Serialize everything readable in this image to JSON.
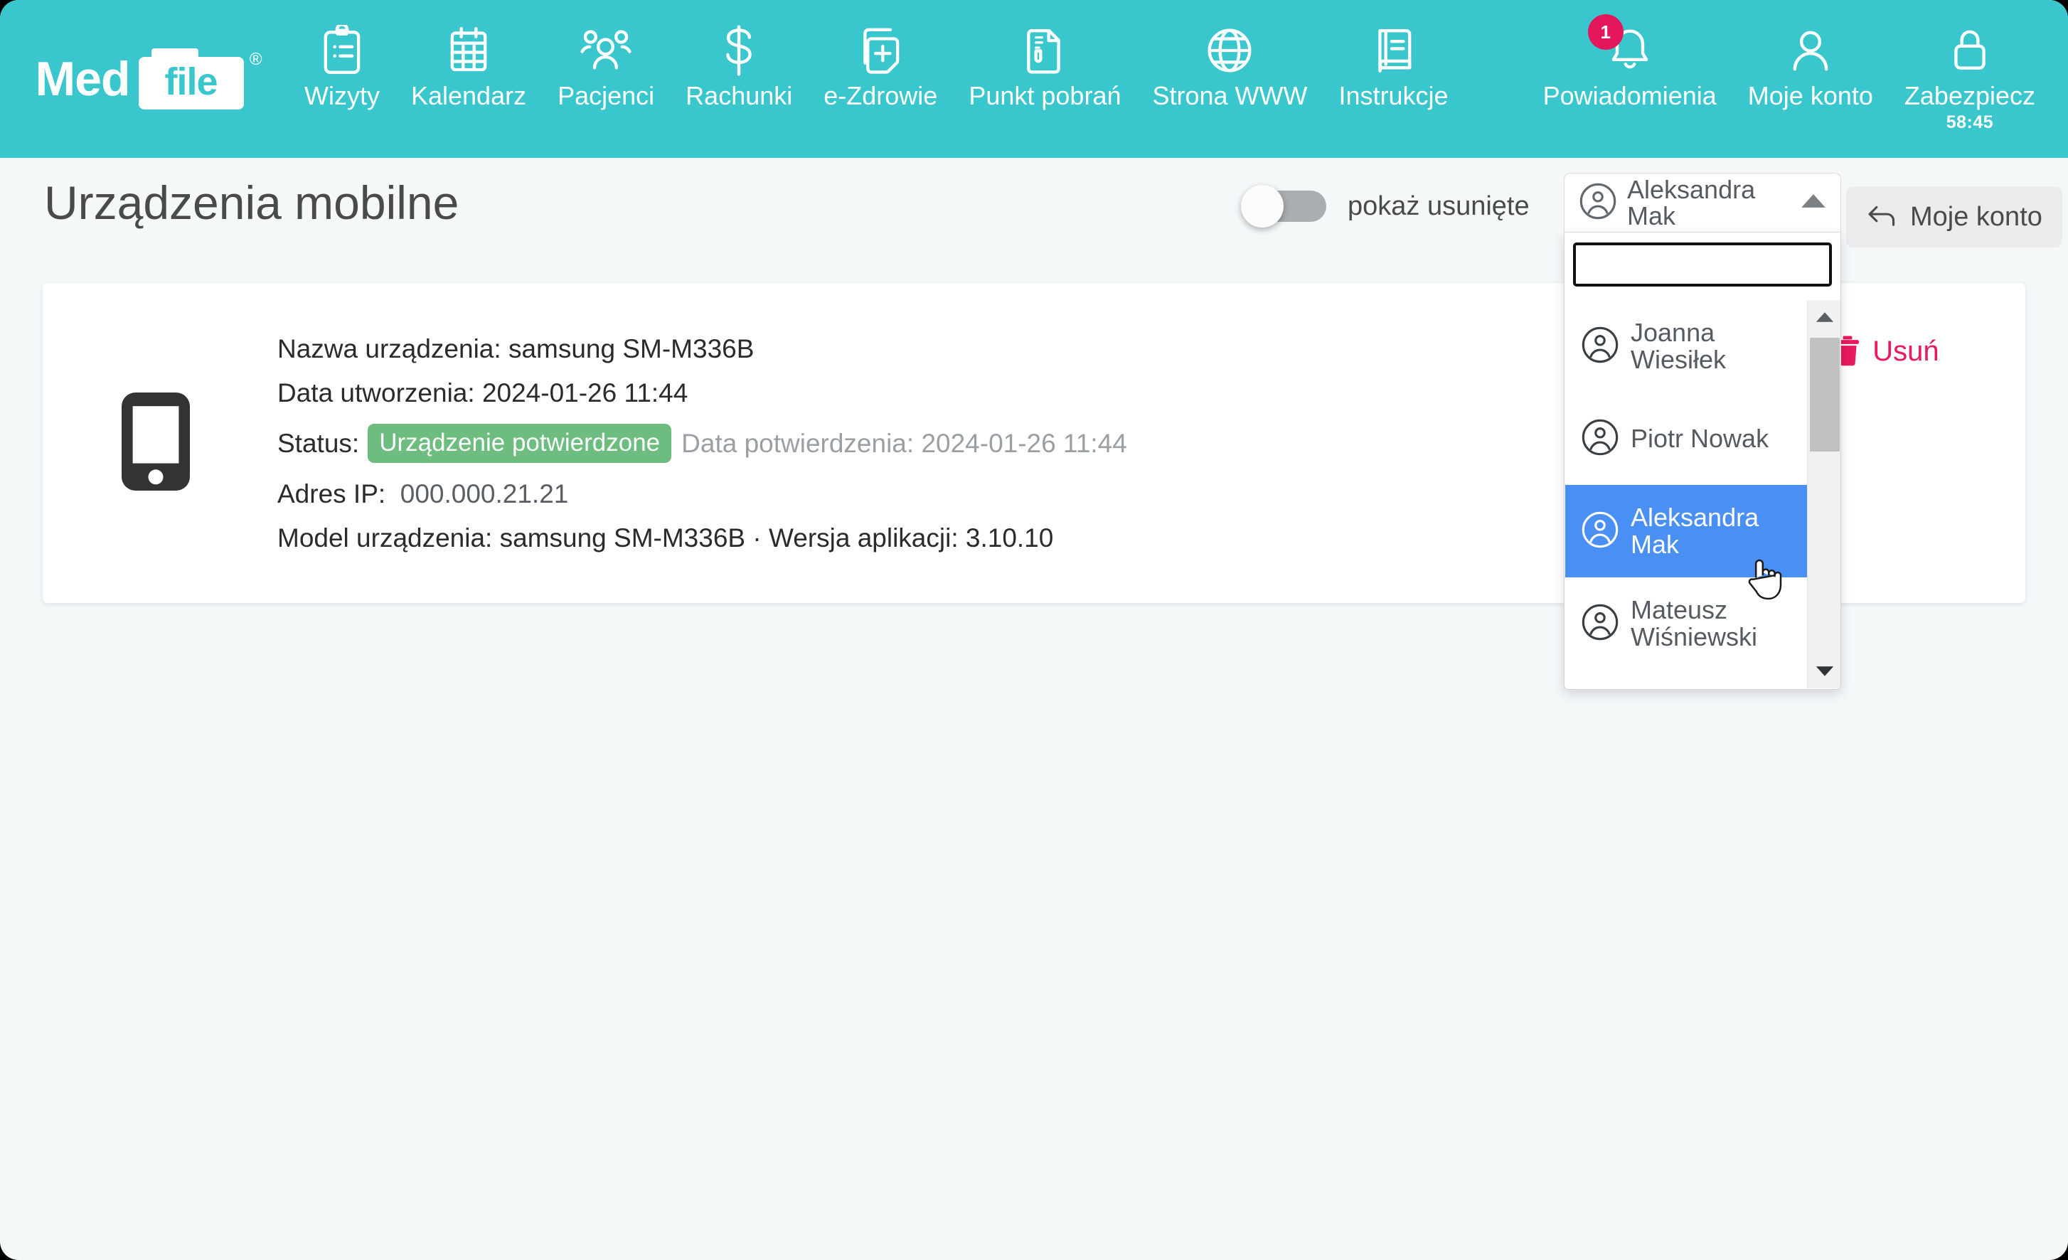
{
  "brand": {
    "word_left": "Med",
    "word_box": "file",
    "registered": "®"
  },
  "nav": {
    "items": [
      {
        "label": "Wizyty",
        "icon": "clipboard-checklist-icon"
      },
      {
        "label": "Kalendarz",
        "icon": "calendar-icon"
      },
      {
        "label": "Pacjenci",
        "icon": "people-group-icon"
      },
      {
        "label": "Rachunki",
        "icon": "dollar-sign-icon"
      },
      {
        "label": "e-Zdrowie",
        "icon": "medical-card-plus-icon"
      },
      {
        "label": "Punkt pobrań",
        "icon": "document-test-tube-icon"
      },
      {
        "label": "Strona WWW",
        "icon": "globe-icon"
      },
      {
        "label": "Instrukcje",
        "icon": "book-icon"
      }
    ],
    "notifications": {
      "label": "Powiadomienia",
      "icon": "bell-icon",
      "badge_count": "1"
    },
    "account": {
      "label": "Moje konto",
      "icon": "person-icon"
    },
    "secure": {
      "label": "Zabezpiecz",
      "icon": "lock-icon",
      "timer": "58:45"
    }
  },
  "page": {
    "title": "Urządzenia mobilne",
    "show_deleted_label": "pokaż usunięte",
    "show_deleted_state": "off",
    "back_button_label": "Moje konto"
  },
  "doctor_select": {
    "selected_label": "Aleksandra Mak",
    "caret": "caret-up-icon",
    "search_value": "",
    "search_placeholder": "",
    "options": [
      {
        "label": "Joanna Wiesiłek",
        "selected": false
      },
      {
        "label": "Piotr Nowak",
        "selected": false
      },
      {
        "label": "Aleksandra Mak",
        "selected": true
      },
      {
        "label": "Mateusz Wiśniewski",
        "selected": false
      }
    ]
  },
  "device": {
    "icon": "smartphone-icon",
    "name_label": "Nazwa urządzenia:",
    "name_value": "samsung SM-M336B",
    "created_label": "Data utworzenia:",
    "created_value": "2024-01-26 11:44",
    "status_label": "Status:",
    "status_badge": "Urządzenie potwierdzone",
    "confirmed_label": "Data potwierdzenia:",
    "confirmed_value": "2024-01-26 11:44",
    "ip_label": "Adres IP:",
    "ip_value": "000.000.21.21",
    "model_label": "Model urządzenia:",
    "model_value": "samsung SM-M336B",
    "model_separator": "·",
    "appversion_label": "Wersja aplikacji:",
    "appversion_value": "3.10.10",
    "delete_label": "Usuń"
  },
  "colors": {
    "brand_teal": "#3ac6cd",
    "accent_pink": "#e8195d",
    "status_green": "#6cbd7f",
    "highlight_blue": "#4a90f4",
    "page_bg": "#f4f8f9"
  }
}
